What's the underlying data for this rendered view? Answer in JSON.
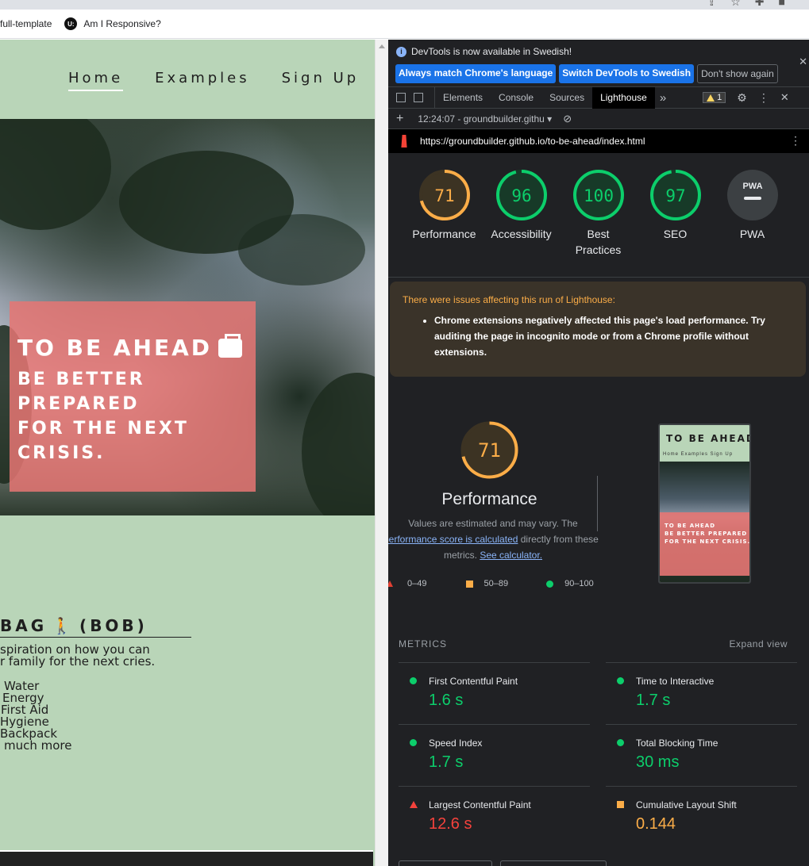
{
  "bookmarks": [
    {
      "label": "full-template"
    },
    {
      "label": "Am I Responsive?",
      "logo": "U:"
    }
  ],
  "site": {
    "nav": [
      "Home",
      "Examples",
      "Sign Up"
    ],
    "hero_title": "TO BE AHEAD",
    "hero_sub1": "BE BETTER PREPARED",
    "hero_sub2": "FOR THE NEXT CRISIS.",
    "bob_title_left": "BAG",
    "bob_title_right": "(BOB)",
    "bob_text1": "spiration on how you can",
    "bob_text2": "r family for the next cries.",
    "bob_list": [
      "Water",
      "Energy",
      "First Aid",
      "Hygiene",
      "Backpack",
      "much more"
    ]
  },
  "devtools": {
    "info_text": "DevTools is now available in Swedish!",
    "btn_match": "Always match Chrome's language",
    "btn_switch": "Switch DevTools to Swedish",
    "btn_dont_show": "Don't show again",
    "tabs": [
      "Elements",
      "Console",
      "Sources",
      "Lighthouse"
    ],
    "more_tabs": "»",
    "warn_count": "1",
    "run_label": "12:24:07 - groundbuilder.githu",
    "url": "https://groundbuilder.github.io/to-be-ahead/index.html"
  },
  "gauges": [
    {
      "score": 71,
      "label": "Performance",
      "color": "#fbad48",
      "ring_bg": "#3c3323"
    },
    {
      "score": 96,
      "label": "Accessibility",
      "color": "#0cce6b",
      "ring_bg": "#173a28"
    },
    {
      "score": 100,
      "label": "Best Practices",
      "color": "#0cce6b",
      "ring_bg": "#173a28"
    },
    {
      "score": 97,
      "label": "SEO",
      "color": "#0cce6b",
      "ring_bg": "#173a28"
    }
  ],
  "pwa": {
    "label": "PWA",
    "badge": "PWA"
  },
  "issues": {
    "title": "There were issues affecting this run of Lighthouse:",
    "item": "Chrome extensions negatively affected this page's load performance. Try auditing the page in incognito mode or from a Chrome profile without extensions."
  },
  "performance": {
    "score": 71,
    "title": "Performance",
    "desc1": "Values are estimated and may vary. The",
    "desc_link": "performance score is calculated",
    "desc2": " directly from these",
    "desc3": "metrics.",
    "calc_link": "See calculator.",
    "legend": [
      "0–49",
      "50–89",
      "90–100"
    ]
  },
  "thumbnail": {
    "title": "TO BE AHEAD",
    "nav": "Home   Examples   Sign Up",
    "line1": "TO BE AHEAD",
    "line2": "BE BETTER PREPARED",
    "line3": "FOR THE NEXT CRISIS."
  },
  "metrics": {
    "heading": "METRICS",
    "expand": "Expand view",
    "items": [
      {
        "label": "First Contentful Paint",
        "value": "1.6 s",
        "status": "green"
      },
      {
        "label": "Time to Interactive",
        "value": "1.7 s",
        "status": "green"
      },
      {
        "label": "Speed Index",
        "value": "1.7 s",
        "status": "green"
      },
      {
        "label": "Total Blocking Time",
        "value": "30 ms",
        "status": "green"
      },
      {
        "label": "Largest Contentful Paint",
        "value": "12.6 s",
        "status": "red"
      },
      {
        "label": "Cumulative Layout Shift",
        "value": "0.144",
        "status": "orange"
      }
    ]
  },
  "colors": {
    "site_bg": "#b9d5b8",
    "hero_box": "#e67673",
    "devtools_bg": "#202124",
    "pass": "#0cce6b",
    "average": "#fbad48",
    "fail": "#f4423c"
  }
}
